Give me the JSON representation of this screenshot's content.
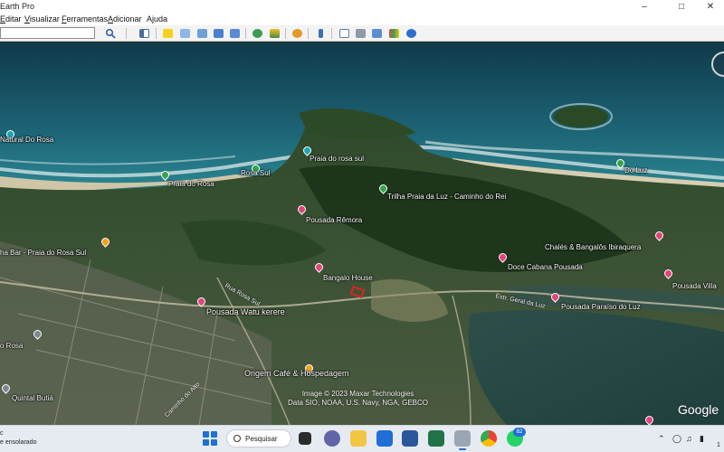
{
  "window": {
    "title": "Earth Pro",
    "minimize_icon": "minimize-icon",
    "maximize_icon": "maximize-icon",
    "close_icon": "close-icon"
  },
  "menu": {
    "items": [
      {
        "label": "Editar",
        "accel": "E"
      },
      {
        "label": "Visualizar",
        "accel": "V"
      },
      {
        "label": "Ferramentas",
        "accel": "F"
      },
      {
        "label": "Adicionar",
        "accel": "A"
      },
      {
        "label": "Ajuda",
        "accel": "j"
      }
    ]
  },
  "toolbar": {
    "search_value": "",
    "buttons": [
      "search-icon",
      "sidebar-icon",
      "placemark-icon",
      "polygon-icon",
      "path-icon",
      "image-overlay-icon",
      "record-tour-icon",
      "historical-imagery-icon",
      "sunlight-icon",
      "planets-icon",
      "ruler-icon",
      "email-icon",
      "print-icon",
      "save-image-icon",
      "google-maps-icon"
    ]
  },
  "map": {
    "places": [
      {
        "label": "Natural Do Rosa",
        "pin": "teal"
      },
      {
        "label": "Praia do rosa sul",
        "pin": "teal"
      },
      {
        "label": "Praia do Rosa",
        "pin": "green"
      },
      {
        "label": "Rosa Sul",
        "pin": "green"
      },
      {
        "label": "Trilha Praia da Luz - Caminho do Rei",
        "pin": "green"
      },
      {
        "label": "Do Luz",
        "pin": "green"
      },
      {
        "label": "Pousada Rêmora",
        "pin": "pink"
      },
      {
        "label": "Chalés & Bangalôs Ibiraquera",
        "pin": "pink"
      },
      {
        "label": "ha Bar - Praia do Rosa Sul",
        "pin": "orange"
      },
      {
        "label": "Bangalo House",
        "pin": "pink"
      },
      {
        "label": "Doce Cabana Pousada",
        "pin": "pink"
      },
      {
        "label": "Pousada Villa",
        "pin": "pink"
      },
      {
        "label": "Pousada Watu kerere",
        "pin": "pink"
      },
      {
        "label": "Pousada Paraíso do Luz",
        "pin": "pink"
      },
      {
        "label": "o Rosa",
        "pin": "gray"
      },
      {
        "label": "Origem Café & Hospedagem",
        "pin": "orange"
      },
      {
        "label": "Quintal Butiá",
        "pin": "gray"
      }
    ],
    "roads": [
      "Estr. Geral da Luz",
      "Rua Rosa Sul",
      "Caminho do Alto"
    ],
    "credits": [
      "Image © 2023 Maxar Technologies",
      "Data SIO, NOAA, U.S. Navy, NGA, GEBCO"
    ],
    "logo": "Google"
  },
  "taskbar": {
    "weather_line1": "c",
    "weather_line2": "e ensolarado",
    "search_label": "Pesquisar",
    "mail_badge": "82",
    "apps": [
      "start-icon",
      "task-view-icon",
      "teams-icon",
      "file-explorer-icon",
      "mail-icon",
      "word-icon",
      "excel-icon",
      "google-earth-icon",
      "chrome-icon",
      "whatsapp-icon"
    ],
    "tray": [
      "chevron-up-icon",
      "wifi-icon",
      "volume-icon",
      "battery-icon"
    ],
    "clock_fragment": "1"
  }
}
